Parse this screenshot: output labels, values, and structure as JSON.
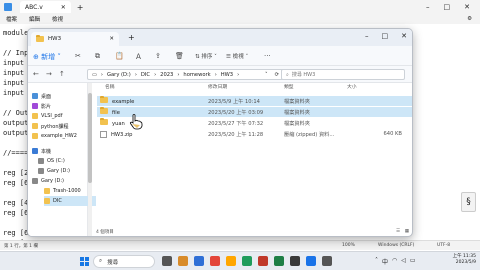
{
  "notepad": {
    "tab_title": "ABC.v",
    "menu": [
      "檔案",
      "編輯",
      "檢視"
    ],
    "lines": [
      "module",
      "",
      "// Inpu",
      "input c",
      "input r",
      "input c",
      "input [",
      "",
      "// Outp",
      "output",
      "output",
      "",
      "//====",
      "",
      "reg [2",
      "reg [6",
      "",
      "reg [4",
      "reg [6",
      "",
      "reg [6",
      "reg [6",
      "",
      "reg [6:0] sum [15:0];"
    ],
    "status": {
      "position": "第 1 行，第 1 欄",
      "zoom": "100%",
      "encoding_lf": "Windows (CRLF)",
      "encoding": "UTF-8"
    }
  },
  "explorer": {
    "tab_title": "HW3",
    "toolbar": {
      "new": "新增",
      "sort": "排序",
      "view": "檢視"
    },
    "address": {
      "parts": [
        "Gary (D:)",
        "DIC",
        "2023",
        "homework",
        "HW3"
      ]
    },
    "search_placeholder": "搜尋 HW3",
    "sidebar": [
      {
        "label": "桌面",
        "color": "#4a90d9"
      },
      {
        "label": "影片",
        "color": "#a04ad9"
      },
      {
        "label": "VLSI_pdf",
        "color": "#f2c24f"
      },
      {
        "label": "python課程",
        "color": "#f2c24f"
      },
      {
        "label": "example_HW2",
        "color": "#f2c24f"
      },
      {
        "label": "本機",
        "color": "#3a7bd5"
      },
      {
        "label": "OS (C:)",
        "color": "#888888"
      },
      {
        "label": "Gary (D:)",
        "color": "#888888"
      },
      {
        "label": "Gary (D:)",
        "color": "#888888"
      },
      {
        "label": "Trash-1000",
        "color": "#f2c24f"
      },
      {
        "label": "DIC",
        "color": "#f2c24f"
      }
    ],
    "columns": {
      "name": "名稱",
      "date": "修改日期",
      "type": "類型",
      "size": "大小"
    },
    "files": [
      {
        "name": "example",
        "date": "2023/5/9 上午 10:14",
        "type": "檔案資料夾",
        "size": "",
        "kind": "folder"
      },
      {
        "name": "file",
        "date": "2023/5/20 上午 03:09",
        "type": "檔案資料夾",
        "size": "",
        "kind": "folder"
      },
      {
        "name": "yuan",
        "date": "2023/5/27 下午 07:32",
        "type": "檔案資料夾",
        "size": "",
        "kind": "folder"
      },
      {
        "name": "HW3.zip",
        "date": "2023/5/20 上午 11:28",
        "type": "壓縮 (zipped) 資料...",
        "size": "640 KB",
        "kind": "zip"
      }
    ],
    "status": "4 個項目"
  },
  "taskbar": {
    "search_label": "搜尋",
    "time": "上午 11:35",
    "date": "2023/5/9",
    "lang": "中",
    "app_colors": [
      "#555555",
      "#d88b2a",
      "#2f6fd6",
      "#e3463a",
      "#ffa600",
      "#1f9c5c",
      "#c0392b",
      "#1e7f46",
      "#3a3a3a",
      "#1a73e8",
      "#555555"
    ]
  }
}
